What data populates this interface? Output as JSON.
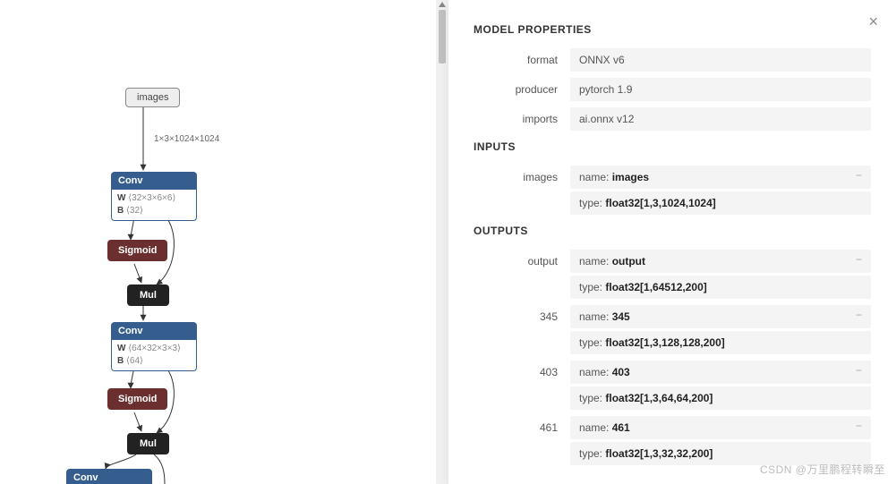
{
  "panel": {
    "title": "MODEL PROPERTIES",
    "sections": {
      "properties": [
        {
          "label": "format",
          "value": "ONNX v6"
        },
        {
          "label": "producer",
          "value": "pytorch 1.9"
        },
        {
          "label": "imports",
          "value": "ai.onnx v12"
        }
      ]
    },
    "inputs_title": "INPUTS",
    "inputs": [
      {
        "label": "images",
        "name_prefix": "name: ",
        "name": "images",
        "type_prefix": "type: ",
        "type": "float32[1,3,1024,1024]"
      }
    ],
    "outputs_title": "OUTPUTS",
    "outputs": [
      {
        "label": "output",
        "name_prefix": "name: ",
        "name": "output",
        "type_prefix": "type: ",
        "type": "float32[1,64512,200]"
      },
      {
        "label": "345",
        "name_prefix": "name: ",
        "name": "345",
        "type_prefix": "type: ",
        "type": "float32[1,3,128,128,200]"
      },
      {
        "label": "403",
        "name_prefix": "name: ",
        "name": "403",
        "type_prefix": "type: ",
        "type": "float32[1,3,64,64,200]"
      },
      {
        "label": "461",
        "name_prefix": "name: ",
        "name": "461",
        "type_prefix": "type: ",
        "type": "float32[1,3,32,32,200]"
      }
    ]
  },
  "graph": {
    "input_node": "images",
    "edge_label_1": "1×3×1024×1024",
    "conv1": {
      "title": "Conv",
      "w_label": "W",
      "w": "⟨32×3×6×6⟩",
      "b_label": "B",
      "b": "⟨32⟩"
    },
    "sigmoid1": "Sigmoid",
    "mul1": "Mul",
    "conv2": {
      "title": "Conv",
      "w_label": "W",
      "w": "⟨64×32×3×3⟩",
      "b_label": "B",
      "b": "⟨64⟩"
    },
    "sigmoid2": "Sigmoid",
    "mul2": "Mul",
    "conv3": {
      "title": "Conv"
    }
  },
  "watermark": "CSDN @万里鹏程转瞬至"
}
